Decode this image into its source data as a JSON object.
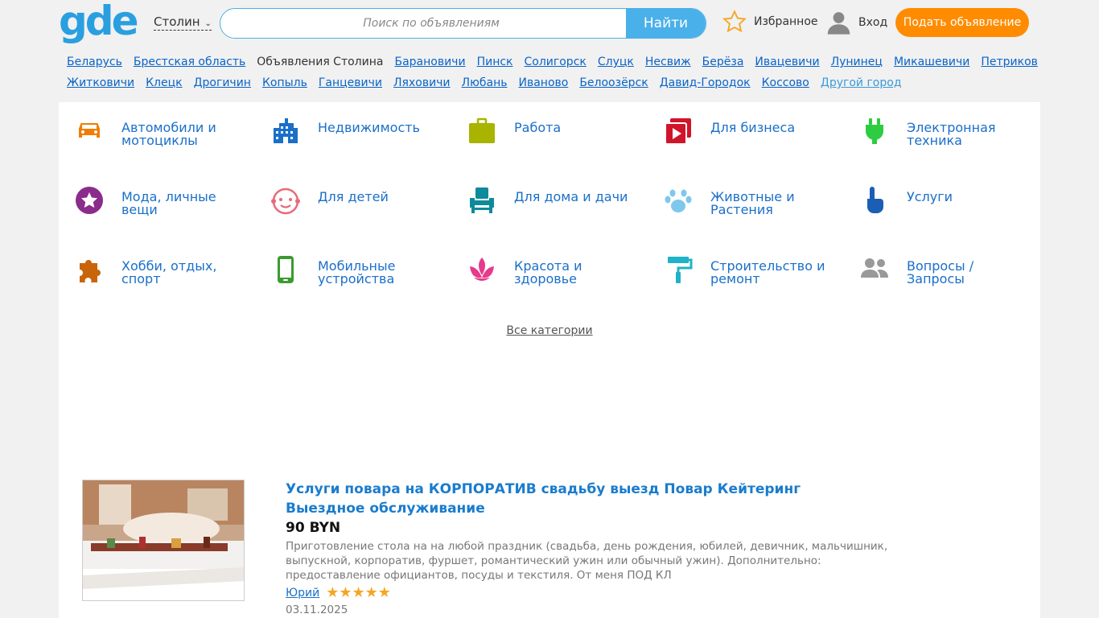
{
  "header": {
    "city": "Столин",
    "search_placeholder": "Поиск по объявлениям",
    "search_button": "Найти",
    "favorites": "Избранное",
    "login": "Вход",
    "post_ad": "Подать объявление"
  },
  "cities_row1": [
    {
      "label": "Беларусь",
      "type": "link"
    },
    {
      "label": "Брестская область",
      "type": "link"
    },
    {
      "label": "Объявления Столина",
      "type": "current"
    },
    {
      "label": "Барановичи",
      "type": "link"
    },
    {
      "label": "Пинск",
      "type": "link"
    },
    {
      "label": "Солигорск",
      "type": "link"
    },
    {
      "label": "Слуцк",
      "type": "link"
    },
    {
      "label": "Несвиж",
      "type": "link"
    },
    {
      "label": "Берёза",
      "type": "link"
    },
    {
      "label": "Ивацевичи",
      "type": "link"
    },
    {
      "label": "Лунинец",
      "type": "link"
    },
    {
      "label": "Микашевичи",
      "type": "link"
    },
    {
      "label": "Петриков",
      "type": "link"
    }
  ],
  "cities_row2": [
    {
      "label": "Житковичи",
      "type": "link"
    },
    {
      "label": "Клецк",
      "type": "link"
    },
    {
      "label": "Дрогичин",
      "type": "link"
    },
    {
      "label": "Копыль",
      "type": "link"
    },
    {
      "label": "Ганцевичи",
      "type": "link"
    },
    {
      "label": "Ляховичи",
      "type": "link"
    },
    {
      "label": "Любань",
      "type": "link"
    },
    {
      "label": "Иваново",
      "type": "link"
    },
    {
      "label": "Белоозёрск",
      "type": "link"
    },
    {
      "label": "Давид-Городок",
      "type": "link"
    },
    {
      "label": "Коссово",
      "type": "link"
    },
    {
      "label": "Другой город",
      "type": "other"
    }
  ],
  "categories": [
    {
      "label": "Автомобили и мотоциклы",
      "icon": "car-icon",
      "color": "#f07d00"
    },
    {
      "label": "Недвижимость",
      "icon": "building-icon",
      "color": "#1a6fc9"
    },
    {
      "label": "Работа",
      "icon": "briefcase-icon",
      "color": "#a8b400"
    },
    {
      "label": "Для бизнеса",
      "icon": "business-video-icon",
      "color": "#d0152a"
    },
    {
      "label": "Электронная техника",
      "icon": "plug-icon",
      "color": "#2ecc40"
    },
    {
      "label": "Мода, личные вещи",
      "icon": "star-badge-icon",
      "color": "#8a2c8c"
    },
    {
      "label": "Для детей",
      "icon": "baby-face-icon",
      "color": "#e86a7a"
    },
    {
      "label": "Для дома и дачи",
      "icon": "armchair-icon",
      "color": "#0e8b9b"
    },
    {
      "label": "Животные и Растения",
      "icon": "paw-icon",
      "color": "#7fc8ec"
    },
    {
      "label": "Услуги",
      "icon": "hand-pointer-icon",
      "color": "#1a5fb4"
    },
    {
      "label": "Хобби, отдых, спорт",
      "icon": "puzzle-icon",
      "color": "#c8650a"
    },
    {
      "label": "Мобильные устройства",
      "icon": "mobile-icon",
      "color": "#3a9b30"
    },
    {
      "label": "Красота и здоровье",
      "icon": "lotus-icon",
      "color": "#e63a8c"
    },
    {
      "label": "Строительство и ремонт",
      "icon": "paint-roller-icon",
      "color": "#20b2c8"
    },
    {
      "label": "Вопросы / Запросы",
      "icon": "users-icon",
      "color": "#999999"
    }
  ],
  "all_categories": "Все категории",
  "listing": {
    "title": "Услуги повара на КОРПОРАТИВ свадьбу выезд Повар Кейтеринг Выездное обслуживание",
    "price": "90 BYN",
    "description": "Приготовление стола на на любой праздник (свадьба, день рождения, юбилей, девичник, мальчишник, выпускной, корпоратив, фуршет, романтический ужин или обычный ужин). Дополнительно: предоставление официантов, посуды и текстиля. От меня ПОД КЛ",
    "seller": "Юрий",
    "rating": 5,
    "date": "03.11.2025"
  }
}
